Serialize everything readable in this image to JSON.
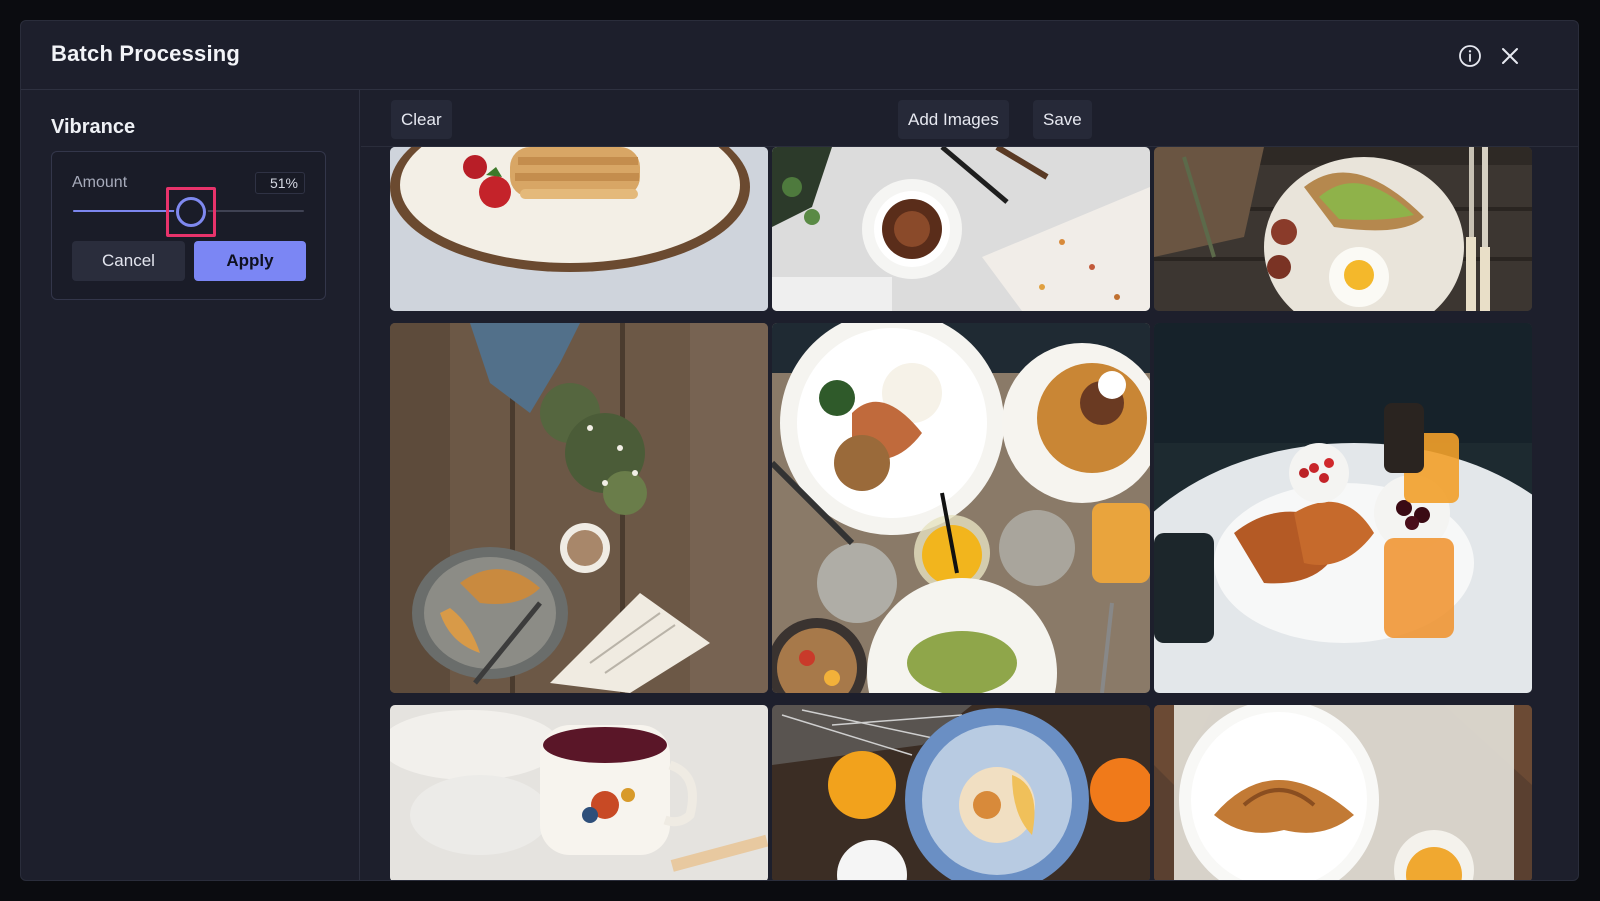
{
  "dialog": {
    "title": "Batch Processing",
    "info_icon": "info-icon",
    "close_icon": "close-icon"
  },
  "sidebar": {
    "section_title": "Vibrance",
    "amount": {
      "label": "Amount",
      "value_text": "51%",
      "value": 0.51
    },
    "cancel_label": "Cancel",
    "apply_label": "Apply"
  },
  "toolbar": {
    "clear_label": "Clear",
    "add_images_label": "Add Images",
    "save_label": "Save"
  },
  "colors": {
    "accent": "#7b86f4",
    "highlight": "#e8336b",
    "background": "#1d1f2c"
  },
  "gallery": {
    "images": [
      "pancakes-with-strawberries",
      "coffee-cup-on-marble",
      "avocado-toast-and-egg",
      "croissant-on-wooden-table-with-flowers",
      "brunch-table-with-eggs-and-juice",
      "croissants-fruit-and-orange-juice",
      "tea-cup-with-bird",
      "pastry-with-orange-juice",
      "croissant-on-tray"
    ]
  }
}
